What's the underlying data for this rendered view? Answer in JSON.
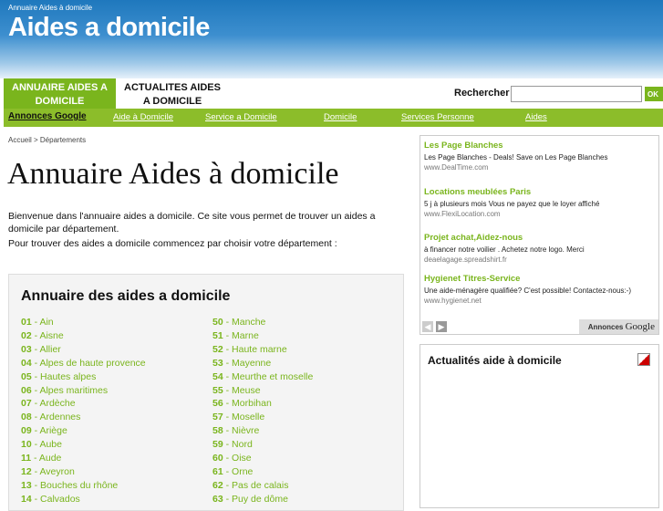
{
  "header": {
    "small_title": "Annuaire Aides à domicile",
    "title": "Aides a domicile"
  },
  "nav": {
    "tab1": "ANNUAIRE AIDES A DOMICILE",
    "tab2": "ACTUALITES AIDES A DOMICILE",
    "search_label": "Rechercher",
    "search_value": "",
    "search_button": "OK"
  },
  "linkbar": [
    "Annonces Google",
    "Aide à Domicile",
    "Service a Domicile",
    "Domicile",
    "Services Personne",
    "Aides"
  ],
  "breadcrumb": "Accueil > Départements",
  "page_title": "Annuaire Aides à domicile",
  "intro": {
    "line1": "Bienvenue dans l'annuaire aides a domicile. Ce site vous permet de trouver un aides a domicile par département.",
    "line2": "Pour trouver des aides a domicile commencez par choisir votre département :"
  },
  "departments": {
    "title": "Annuaire des aides a domicile",
    "left": [
      [
        "01",
        "Ain"
      ],
      [
        "02",
        "Aisne"
      ],
      [
        "03",
        "Allier"
      ],
      [
        "04",
        "Alpes de haute provence"
      ],
      [
        "05",
        "Hautes alpes"
      ],
      [
        "06",
        "Alpes maritimes"
      ],
      [
        "07",
        "Ardèche"
      ],
      [
        "08",
        "Ardennes"
      ],
      [
        "09",
        "Ariège"
      ],
      [
        "10",
        "Aube"
      ],
      [
        "11",
        "Aude"
      ],
      [
        "12",
        "Aveyron"
      ],
      [
        "13",
        "Bouches du rhône"
      ],
      [
        "14",
        "Calvados"
      ]
    ],
    "right": [
      [
        "50",
        "Manche"
      ],
      [
        "51",
        "Marne"
      ],
      [
        "52",
        "Haute marne"
      ],
      [
        "53",
        "Mayenne"
      ],
      [
        "54",
        "Meurthe et moselle"
      ],
      [
        "55",
        "Meuse"
      ],
      [
        "56",
        "Morbihan"
      ],
      [
        "57",
        "Moselle"
      ],
      [
        "58",
        "Nièvre"
      ],
      [
        "59",
        "Nord"
      ],
      [
        "60",
        "Oise"
      ],
      [
        "61",
        "Orne"
      ],
      [
        "62",
        "Pas de calais"
      ],
      [
        "63",
        "Puy de dôme"
      ]
    ]
  },
  "ads": [
    {
      "title": "Les Page Blanches",
      "text": "Les Page Blanches - Deals! Save on Les Page Blanches",
      "url": "www.DealTime.com"
    },
    {
      "title": "Locations meublées Paris",
      "text": "5 j à plusieurs mois Vous ne payez que le loyer affiché",
      "url": "www.FlexiLocation.com"
    },
    {
      "title": "Projet achat,Aidez-nous",
      "text": "à financer notre voilier . Achetez notre logo. Merci",
      "url": "deaelagage.spreadshirt.fr"
    },
    {
      "title": "Hygienet Titres-Service",
      "text": "Une aide-ménagère qualifiée? C'est possible! Contactez-nous:-)",
      "url": "www.hygienet.net"
    }
  ],
  "ads_brand": {
    "prefix": "Annonces",
    "brand": "Google"
  },
  "news": {
    "title": "Actualités aide à domicile"
  }
}
